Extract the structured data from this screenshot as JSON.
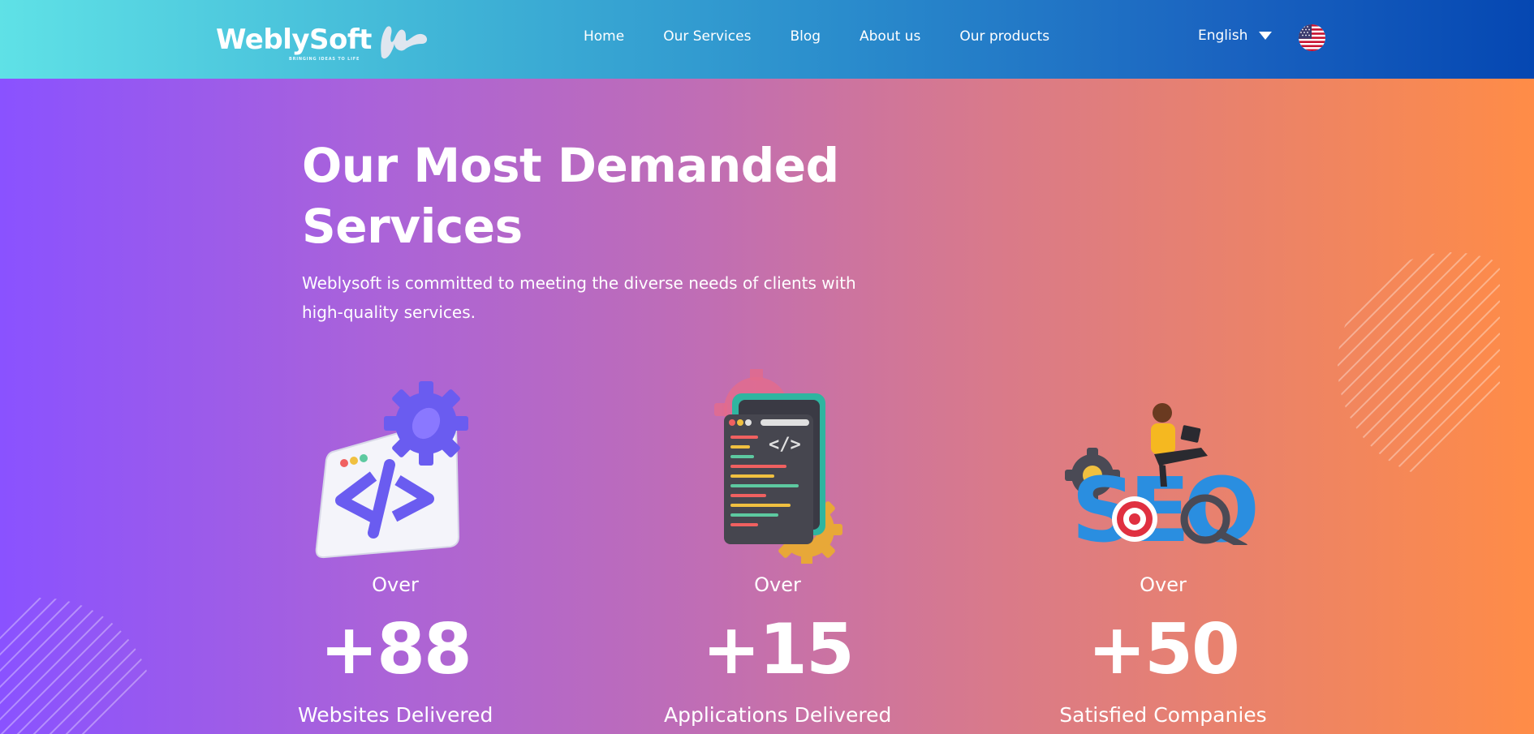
{
  "brand": {
    "name": "WeblySoft",
    "tagline": "BRINGING IDEAS TO LIFE"
  },
  "nav": {
    "items": [
      {
        "label": "Home"
      },
      {
        "label": "Our Services"
      },
      {
        "label": "Blog"
      },
      {
        "label": "About us"
      },
      {
        "label": "Our products"
      }
    ]
  },
  "language": {
    "selected": "English",
    "icon": "chevron-down-icon",
    "flag": "us-flag-icon"
  },
  "hero": {
    "title": "Our Most Demanded Services",
    "description": "Weblysoft is committed to meeting the diverse needs of clients with high-quality services."
  },
  "stats": [
    {
      "prefix": "Over",
      "value": "+88",
      "label": "Websites Delivered",
      "icon": "web-development-icon"
    },
    {
      "prefix": "Over",
      "value": "+15",
      "label": "Applications Delivered",
      "icon": "mobile-app-icon"
    },
    {
      "prefix": "Over",
      "value": "+50",
      "label": "Satisfied Companies",
      "icon": "seo-icon"
    }
  ],
  "colors": {
    "header_start": "#5fe1e6",
    "header_end": "#0547b2",
    "hero_start": "#8a52ff",
    "hero_end": "#ff8c47",
    "text": "#ffffff"
  }
}
